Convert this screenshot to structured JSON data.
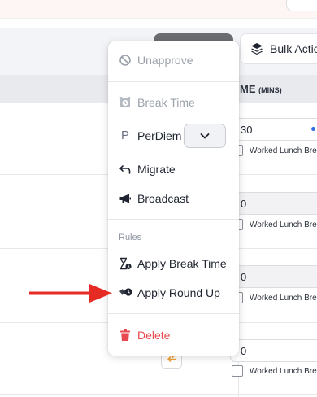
{
  "toolbar": {
    "bulk_actions_label": "Bulk Actio"
  },
  "table": {
    "column_header": {
      "title": "ME",
      "unit": "(MINS)"
    },
    "rows": [
      {
        "time_value": "30",
        "checkbox_label": "Worked Lunch Brea"
      },
      {
        "time_value": "0",
        "checkbox_label": "Worked Lunch Brea"
      },
      {
        "time_value": "0",
        "checkbox_label": "Worked Lunch Brea"
      },
      {
        "time_value": "0",
        "checkbox_label": "Worked Lunch Brea"
      }
    ]
  },
  "menu": {
    "items": {
      "unapprove": {
        "label": "Unapprove",
        "icon": "ban-icon",
        "disabled": true
      },
      "break_time": {
        "label": "Break Time",
        "icon": "alarm-clock-icon",
        "disabled": true
      },
      "perdiem": {
        "label": "PerDiem",
        "icon": "p-letter-icon",
        "select_icon": "chevron-down-icon"
      },
      "migrate": {
        "label": "Migrate",
        "icon": "return-arrow-icon"
      },
      "broadcast": {
        "label": "Broadcast",
        "icon": "megaphone-icon"
      }
    },
    "rules_section": {
      "title": "Rules",
      "apply_break_time": {
        "label": "Apply Break Time",
        "icon": "hourglass-clock-icon"
      },
      "apply_round_up": {
        "label": "Apply Round Up",
        "icon": "round-up-clock-icon"
      }
    },
    "delete": {
      "label": "Delete",
      "icon": "trash-icon",
      "color": "#e8484f"
    }
  },
  "annotation": {
    "arrow_color": "#e52b24"
  },
  "colors": {
    "accent_blue": "#2f6ce5",
    "swap_icon": "#f2a33a",
    "disabled_text": "#9aa0aa"
  }
}
